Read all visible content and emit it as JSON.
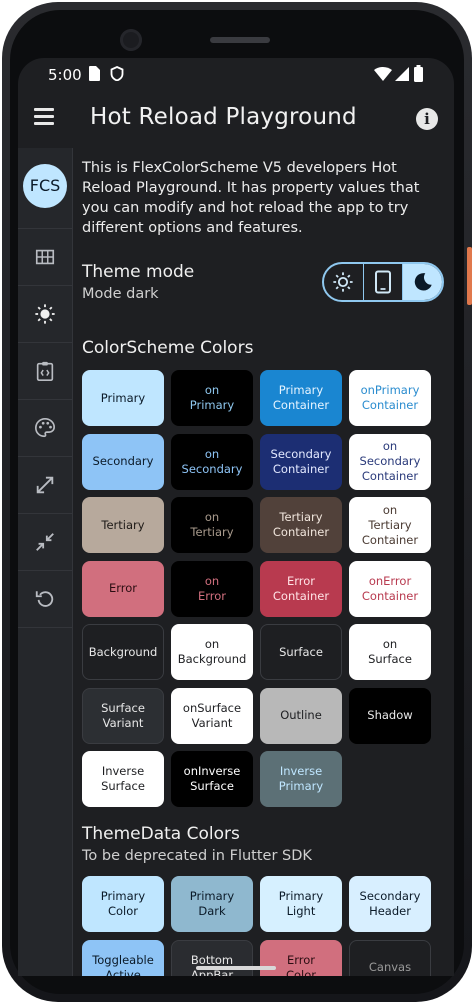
{
  "status_bar": {
    "time": "5:00"
  },
  "app_bar": {
    "title": "Hot Reload Playground",
    "info_glyph": "i"
  },
  "nav_rail": {
    "avatar_text": "FCS",
    "items": [
      {
        "name": "grid-icon"
      },
      {
        "name": "brightness-icon"
      },
      {
        "name": "code-clipboard-icon"
      },
      {
        "name": "palette-icon"
      },
      {
        "name": "expand-icon"
      },
      {
        "name": "collapse-icon"
      },
      {
        "name": "reset-icon"
      }
    ]
  },
  "intro_text": "This is FlexColorScheme V5 developers Hot Reload Playground. It has property values that you can modify and hot reload the app to try different options and features.",
  "theme_mode": {
    "title": "Theme mode",
    "subtitle": "Mode dark",
    "options": [
      "light-mode-icon",
      "system-mode-icon",
      "dark-mode-icon"
    ],
    "selected": 2
  },
  "color_scheme": {
    "title": "ColorScheme Colors",
    "tiles": [
      {
        "label": "Primary",
        "bg": "#bfe6ff",
        "fg": "#0b1a28",
        "border": "#bfe6ff"
      },
      {
        "label": "on\nPrimary",
        "bg": "#000000",
        "fg": "#8fc8ef",
        "border": "#000000"
      },
      {
        "label": "Primary\nContainer",
        "bg": "#1a86d1",
        "fg": "#e6f4ff",
        "border": "#1a86d1"
      },
      {
        "label": "onPrimary\nContainer",
        "bg": "#ffffff",
        "fg": "#2a8ccf",
        "border": "#ffffff"
      },
      {
        "label": "Secondary",
        "bg": "#8ec4f6",
        "fg": "#0b1a28",
        "border": "#8ec4f6"
      },
      {
        "label": "on\nSecondary",
        "bg": "#000000",
        "fg": "#8ec4f6",
        "border": "#000000"
      },
      {
        "label": "Secondary\nContainer",
        "bg": "#1c2e73",
        "fg": "#e3e9ff",
        "border": "#1c2e73"
      },
      {
        "label": "on\nSecondary\nContainer",
        "bg": "#ffffff",
        "fg": "#2a3a7a",
        "border": "#ffffff"
      },
      {
        "label": "Tertiary",
        "bg": "#b7a99c",
        "fg": "#1e1a17",
        "border": "#b7a99c"
      },
      {
        "label": "on\nTertiary",
        "bg": "#000000",
        "fg": "#a89a8c",
        "border": "#000000"
      },
      {
        "label": "Tertiary\nContainer",
        "bg": "#51413a",
        "fg": "#f1e6dd",
        "border": "#51413a"
      },
      {
        "label": "on\nTertiary\nContainer",
        "bg": "#ffffff",
        "fg": "#4a3a32",
        "border": "#ffffff"
      },
      {
        "label": "Error",
        "bg": "#d16f7e",
        "fg": "#2b0d12",
        "border": "#d16f7e"
      },
      {
        "label": "on\nError",
        "bg": "#000000",
        "fg": "#d16f7e",
        "border": "#000000"
      },
      {
        "label": "Error\nContainer",
        "bg": "#b83a4f",
        "fg": "#ffe3e6",
        "border": "#b83a4f"
      },
      {
        "label": "onError\nContainer",
        "bg": "#ffffff",
        "fg": "#b83a4f",
        "border": "#ffffff"
      },
      {
        "label": "Background",
        "bg": "#1e1f22",
        "fg": "#e8e8e8",
        "border": "#3a3c41"
      },
      {
        "label": "on\nBackground",
        "bg": "#ffffff",
        "fg": "#1e1f22",
        "border": "#ffffff"
      },
      {
        "label": "Surface",
        "bg": "#1e1f22",
        "fg": "#e8e8e8",
        "border": "#3a3c41"
      },
      {
        "label": "on\nSurface",
        "bg": "#ffffff",
        "fg": "#1e1f22",
        "border": "#ffffff"
      },
      {
        "label": "Surface\nVariant",
        "bg": "#2c2f33",
        "fg": "#e8e8e8",
        "border": "#3a3c41"
      },
      {
        "label": "onSurface\nVariant",
        "bg": "#ffffff",
        "fg": "#1e1f22",
        "border": "#ffffff"
      },
      {
        "label": "Outline",
        "bg": "#b8b8b8",
        "fg": "#1e1f22",
        "border": "#b8b8b8"
      },
      {
        "label": "Shadow",
        "bg": "#000000",
        "fg": "#e8e8e8",
        "border": "#000000"
      },
      {
        "label": "Inverse\nSurface",
        "bg": "#ffffff",
        "fg": "#1e1f22",
        "border": "#ffffff"
      },
      {
        "label": "onInverse\nSurface",
        "bg": "#000000",
        "fg": "#ffffff",
        "border": "#000000"
      },
      {
        "label": "Inverse\nPrimary",
        "bg": "#5c7076",
        "fg": "#bfe6ff",
        "border": "#5c7076"
      }
    ]
  },
  "theme_data": {
    "title": "ThemeData Colors",
    "subtitle": "To be deprecated in Flutter SDK",
    "tiles": [
      {
        "label": "Primary\nColor",
        "bg": "#bfe6ff",
        "fg": "#0b1a28",
        "border": "#bfe6ff"
      },
      {
        "label": "Primary\nDark",
        "bg": "#8fb8cf",
        "fg": "#0b1a28",
        "border": "#8fb8cf"
      },
      {
        "label": "Primary\nLight",
        "bg": "#d6f0ff",
        "fg": "#0b1a28",
        "border": "#d6f0ff"
      },
      {
        "label": "Secondary\nHeader",
        "bg": "#d8efff",
        "fg": "#0b1a28",
        "border": "#d8efff"
      },
      {
        "label": "Toggleable\nActive",
        "bg": "#8ec4f6",
        "fg": "#0b1a28",
        "border": "#8ec4f6"
      },
      {
        "label": "Bottom\nAppBar",
        "bg": "#2a2c30",
        "fg": "#e8e8e8",
        "border": "#3a3c41"
      },
      {
        "label": "Error\nColor",
        "bg": "#d16f7e",
        "fg": "#2b0d12",
        "border": "#d16f7e"
      },
      {
        "label": "Canvas",
        "bg": "#1e1f22",
        "fg": "#9a9a9a",
        "border": "#3a3c41"
      }
    ]
  }
}
